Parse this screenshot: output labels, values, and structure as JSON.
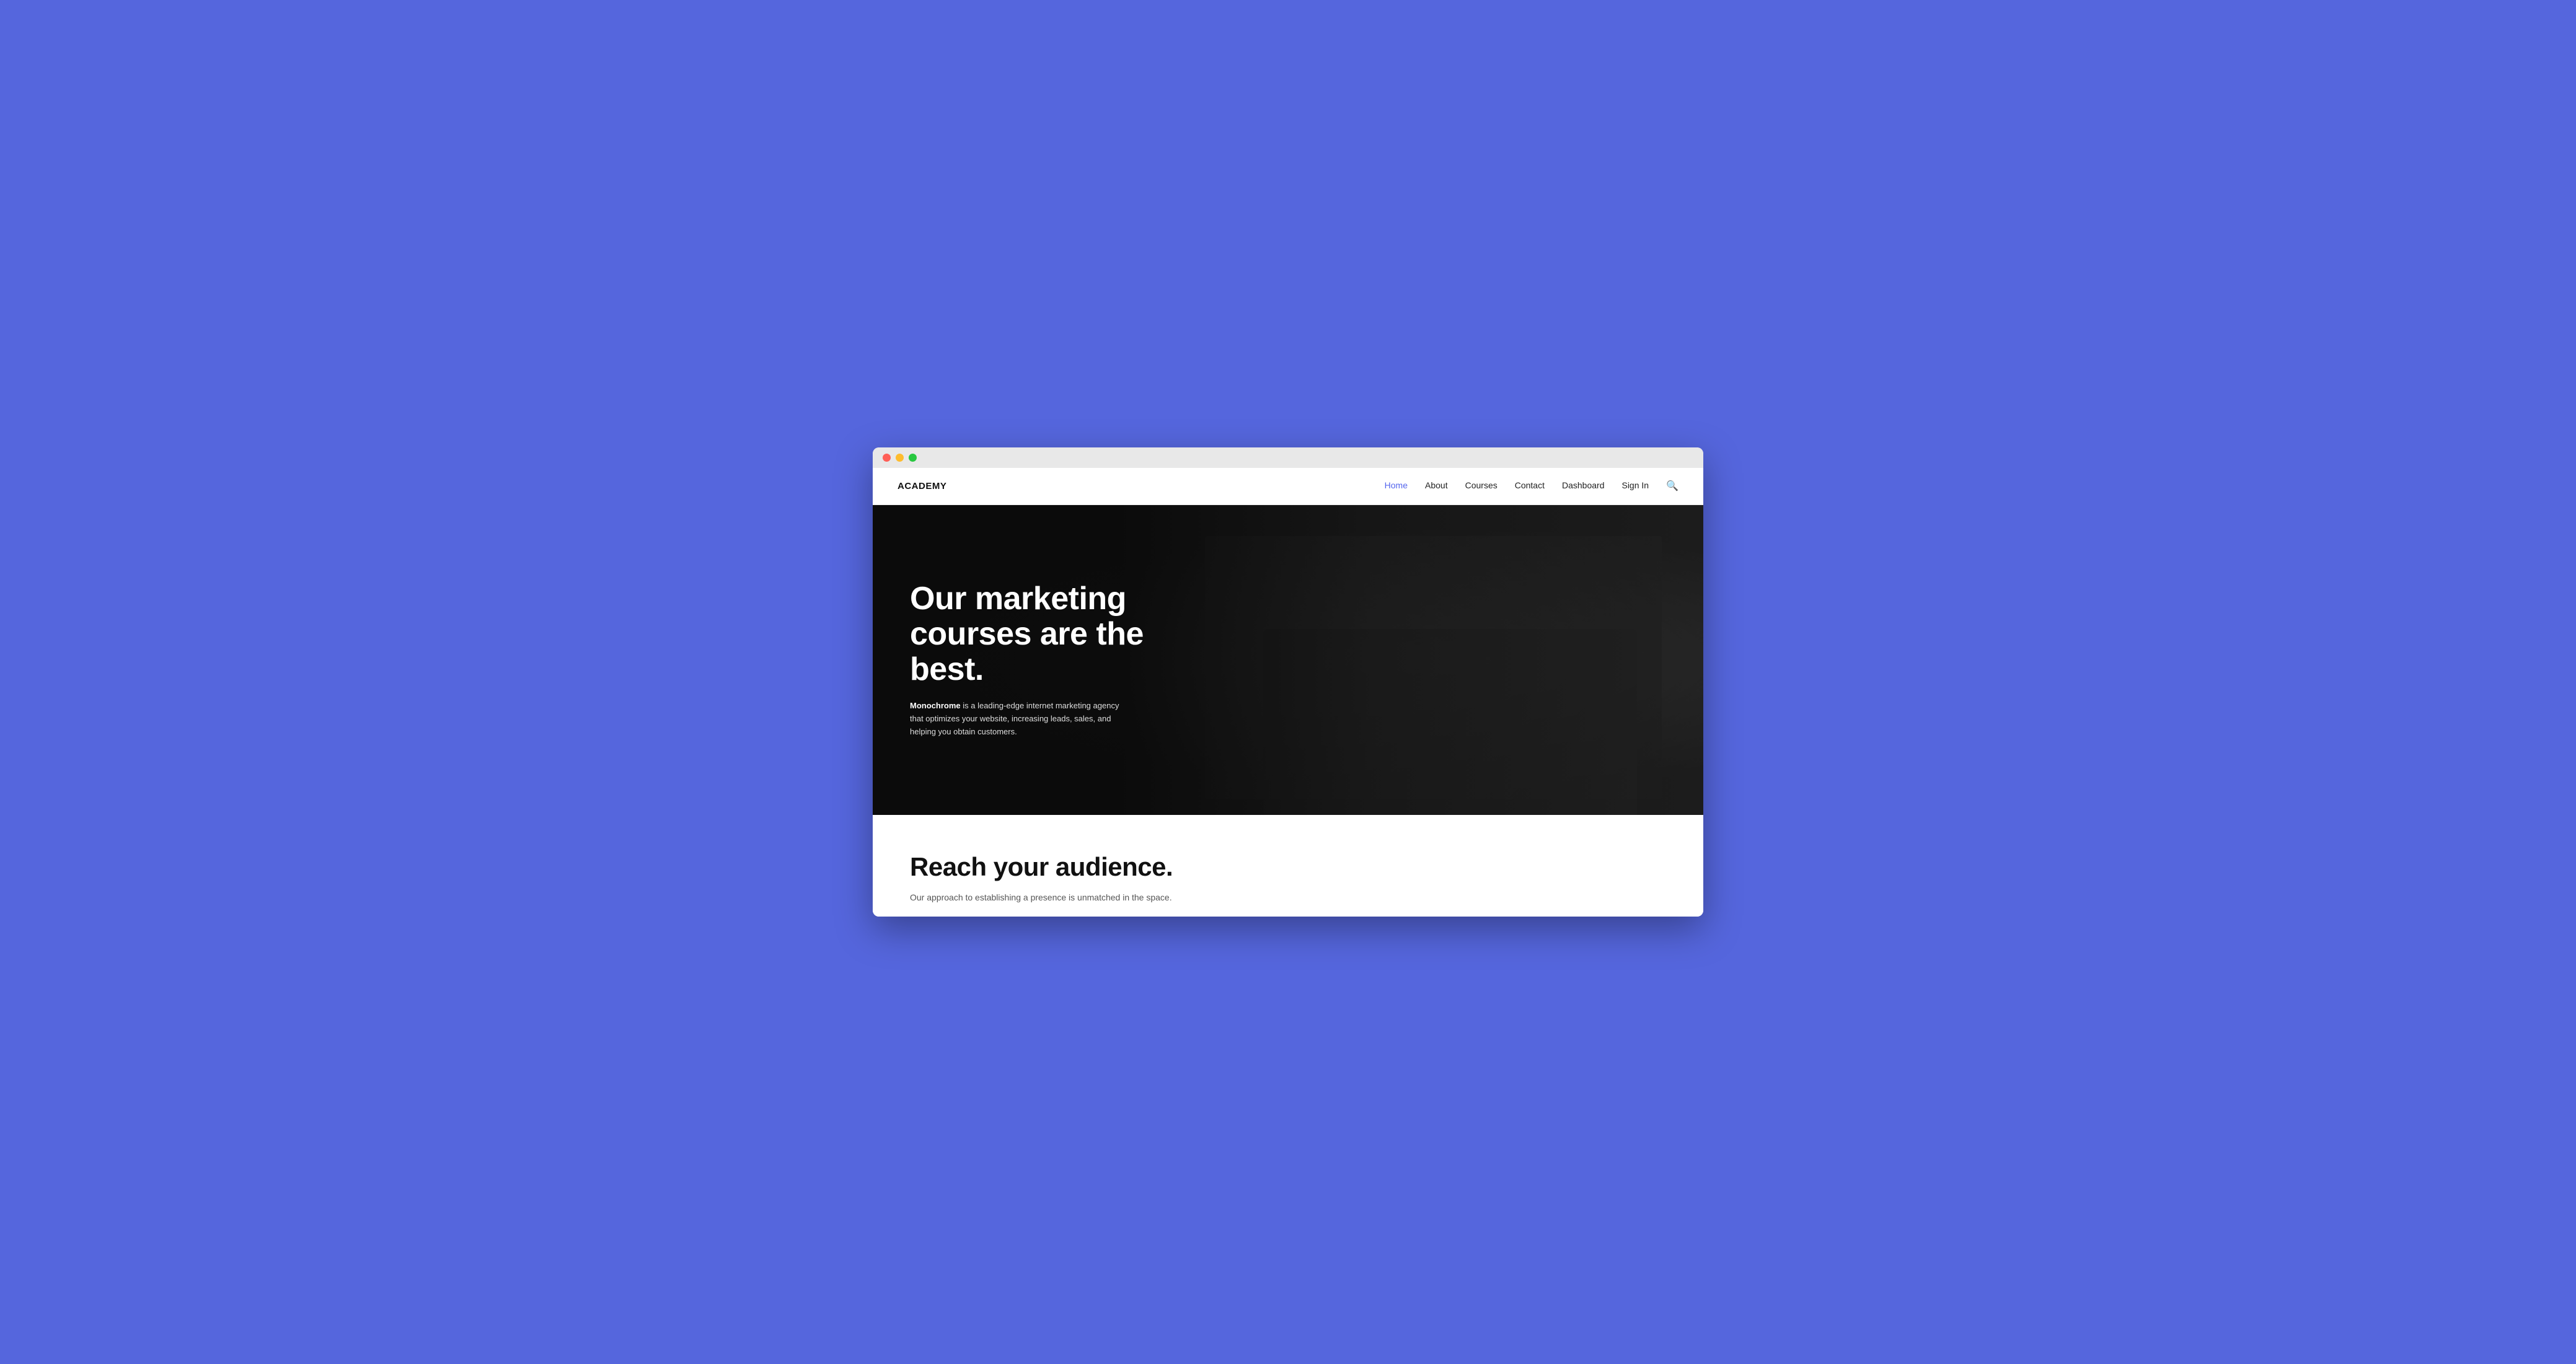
{
  "browser": {
    "traffic_lights": [
      "red",
      "yellow",
      "green"
    ]
  },
  "navbar": {
    "logo": "ACADEMY",
    "links": [
      {
        "label": "Home",
        "active": true
      },
      {
        "label": "About",
        "active": false
      },
      {
        "label": "Courses",
        "active": false
      },
      {
        "label": "Contact",
        "active": false
      },
      {
        "label": "Dashboard",
        "active": false
      },
      {
        "label": "Sign In",
        "active": false
      }
    ]
  },
  "hero": {
    "title": "Our marketing courses are the best.",
    "description_brand": "Monochrome",
    "description_text": " is a leading-edge internet marketing agency that optimizes your website, increasing leads, sales, and helping you obtain customers."
  },
  "below_hero": {
    "title": "Reach your audience.",
    "subtitle": "Our approach to establishing a presence is unmatched in the space."
  },
  "colors": {
    "accent": "#5566ee",
    "background": "#5566dd"
  }
}
